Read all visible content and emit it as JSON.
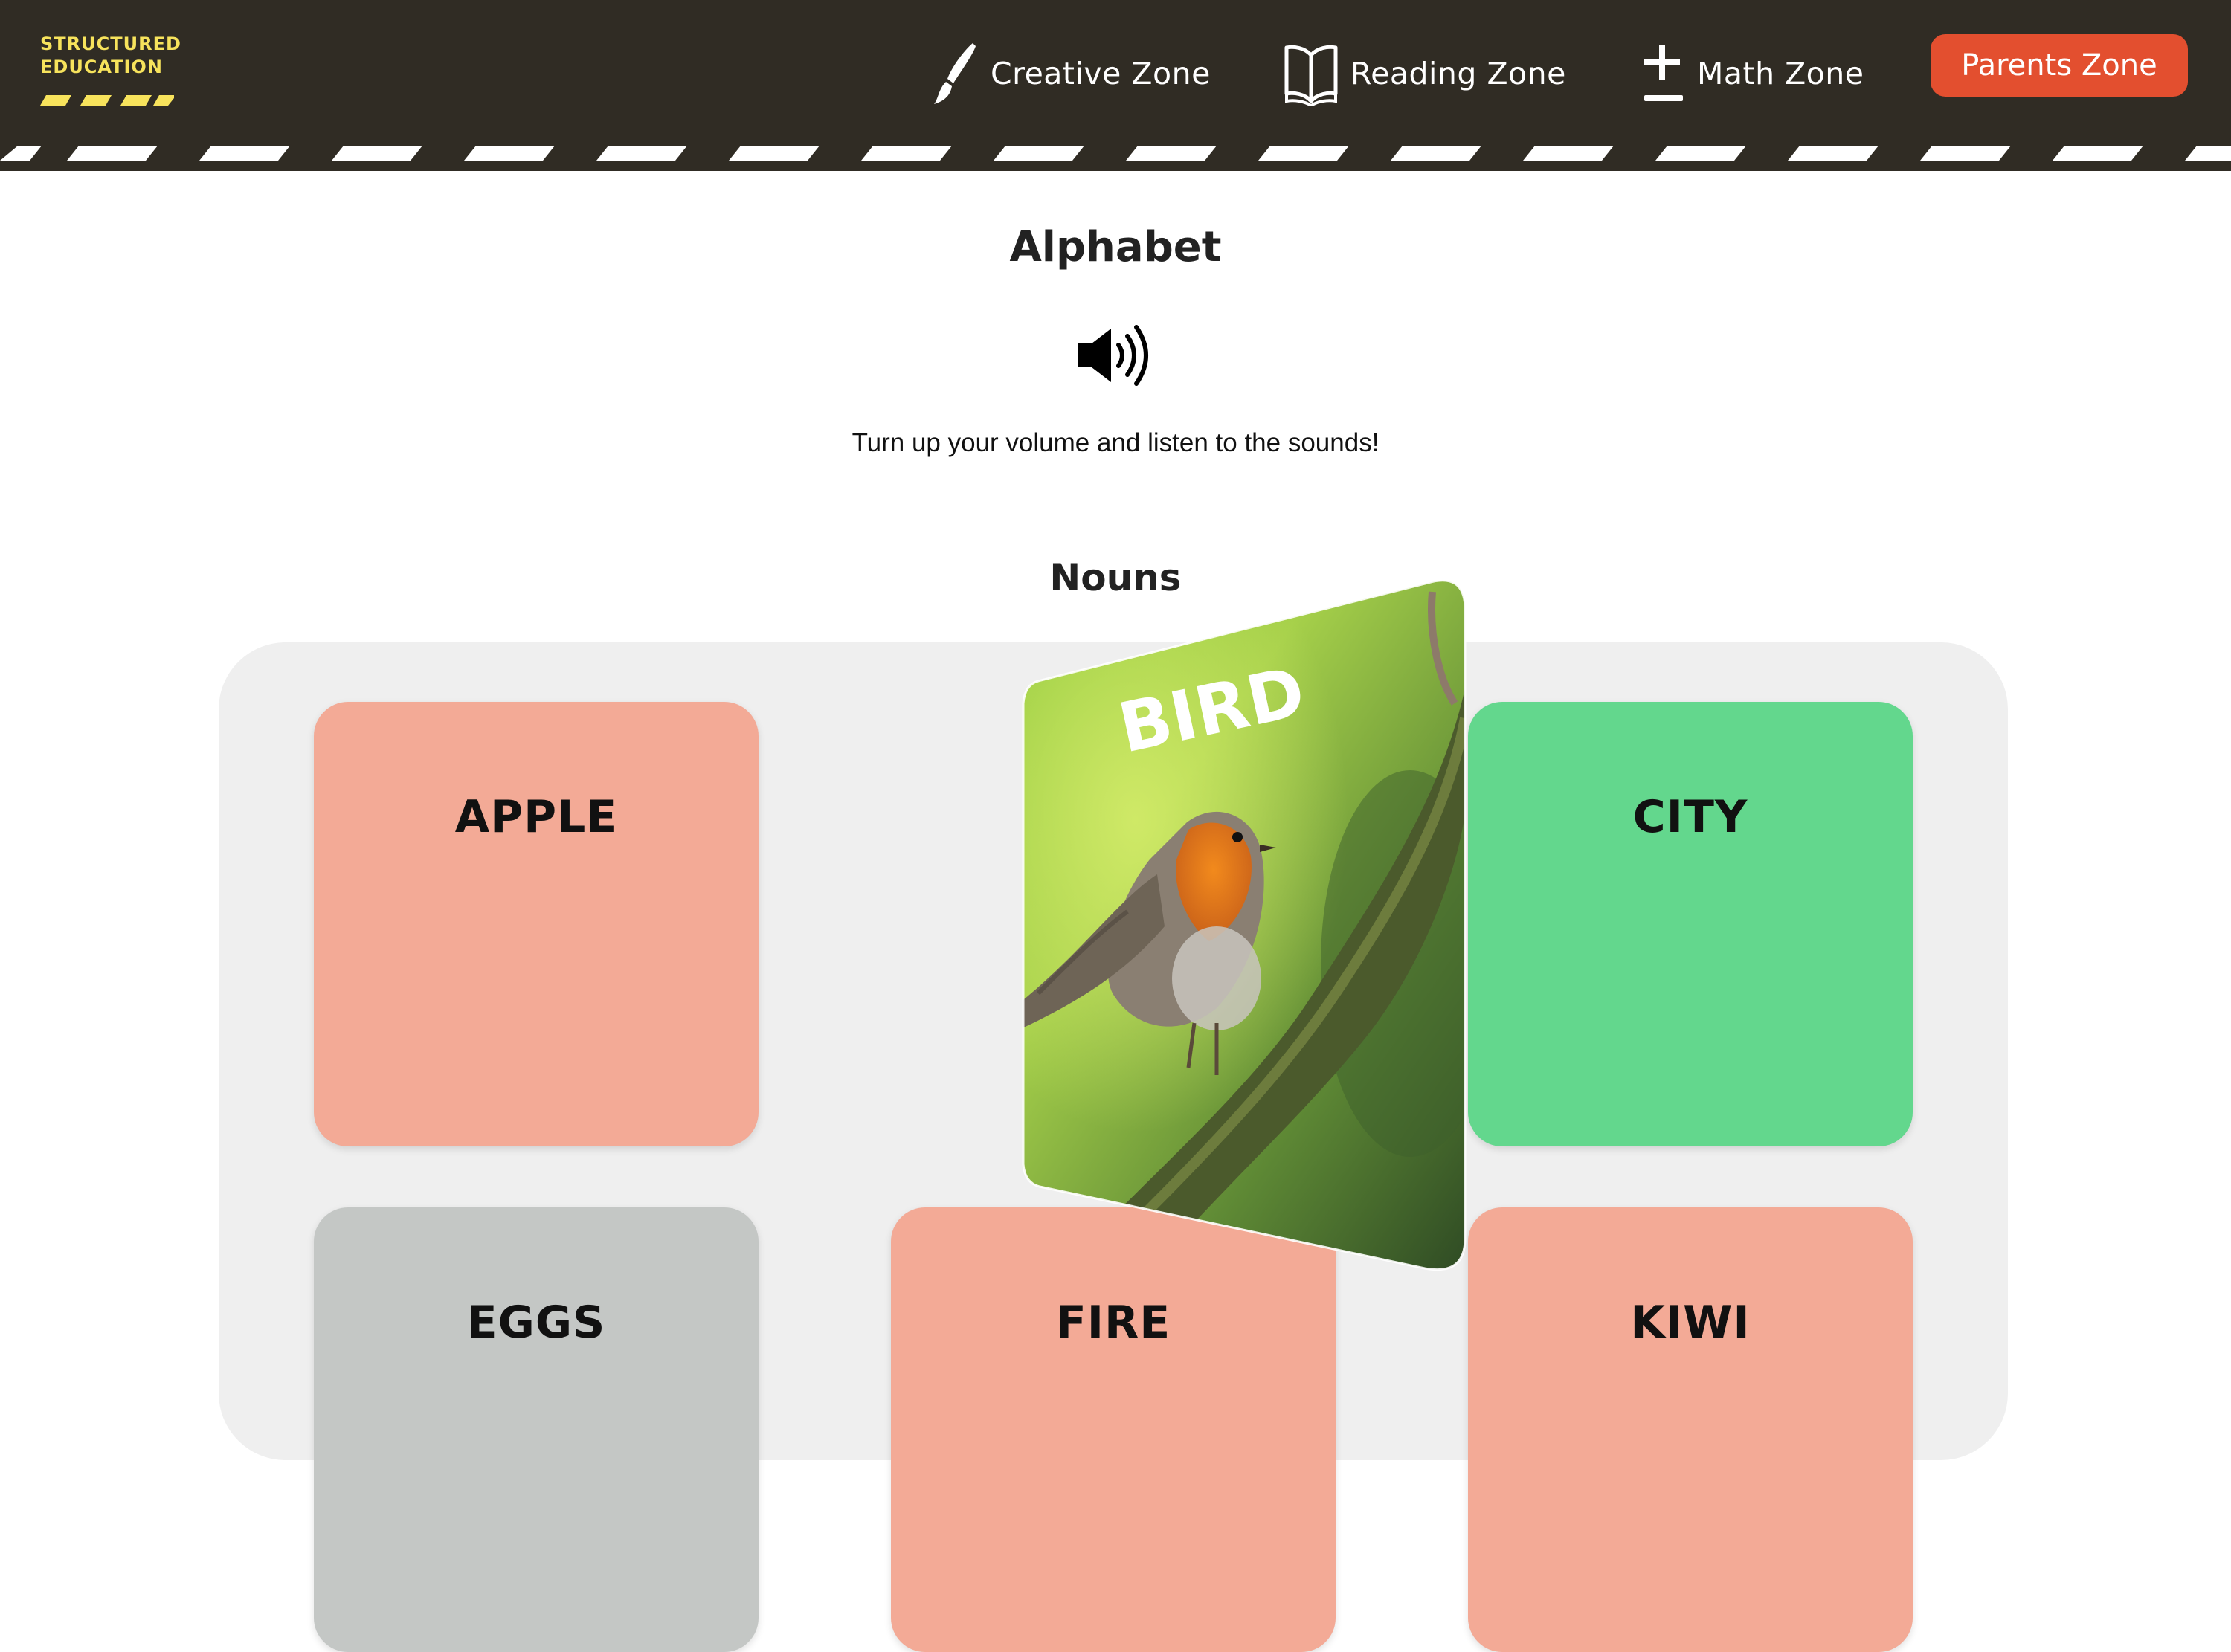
{
  "header": {
    "logo": {
      "line1": "STRUCTURED",
      "line2": "EDUCATION"
    },
    "nav": [
      {
        "label": "Creative Zone",
        "icon": "paintbrush-icon"
      },
      {
        "label": "Reading Zone",
        "icon": "open-book-icon"
      },
      {
        "label": "Math Zone",
        "icon": "plus-minus-icon"
      }
    ],
    "parents_button": "Parents Zone"
  },
  "page": {
    "title": "Alphabet",
    "speaker_icon": "speaker-volume-icon",
    "instructions": "Turn up your volume and listen to the sounds!",
    "section_title": "Nouns"
  },
  "cards": [
    {
      "word": "APPLE",
      "color": "#f3aa96"
    },
    {
      "word": "BIRD",
      "color": "#8fcf5a",
      "state": "flipping",
      "image": "robin-on-branch"
    },
    {
      "word": "CITY",
      "color": "#63d78d"
    },
    {
      "word": "EGGS",
      "color": "#c4c7c5"
    },
    {
      "word": "FIRE",
      "color": "#f3aa96"
    },
    {
      "word": "KIWI",
      "color": "#f3aa96"
    }
  ],
  "colors": {
    "header_bg": "#302c24",
    "logo_yellow": "#f7e35c",
    "accent_orange": "#e34f2f",
    "panel_bg": "#efefef"
  }
}
